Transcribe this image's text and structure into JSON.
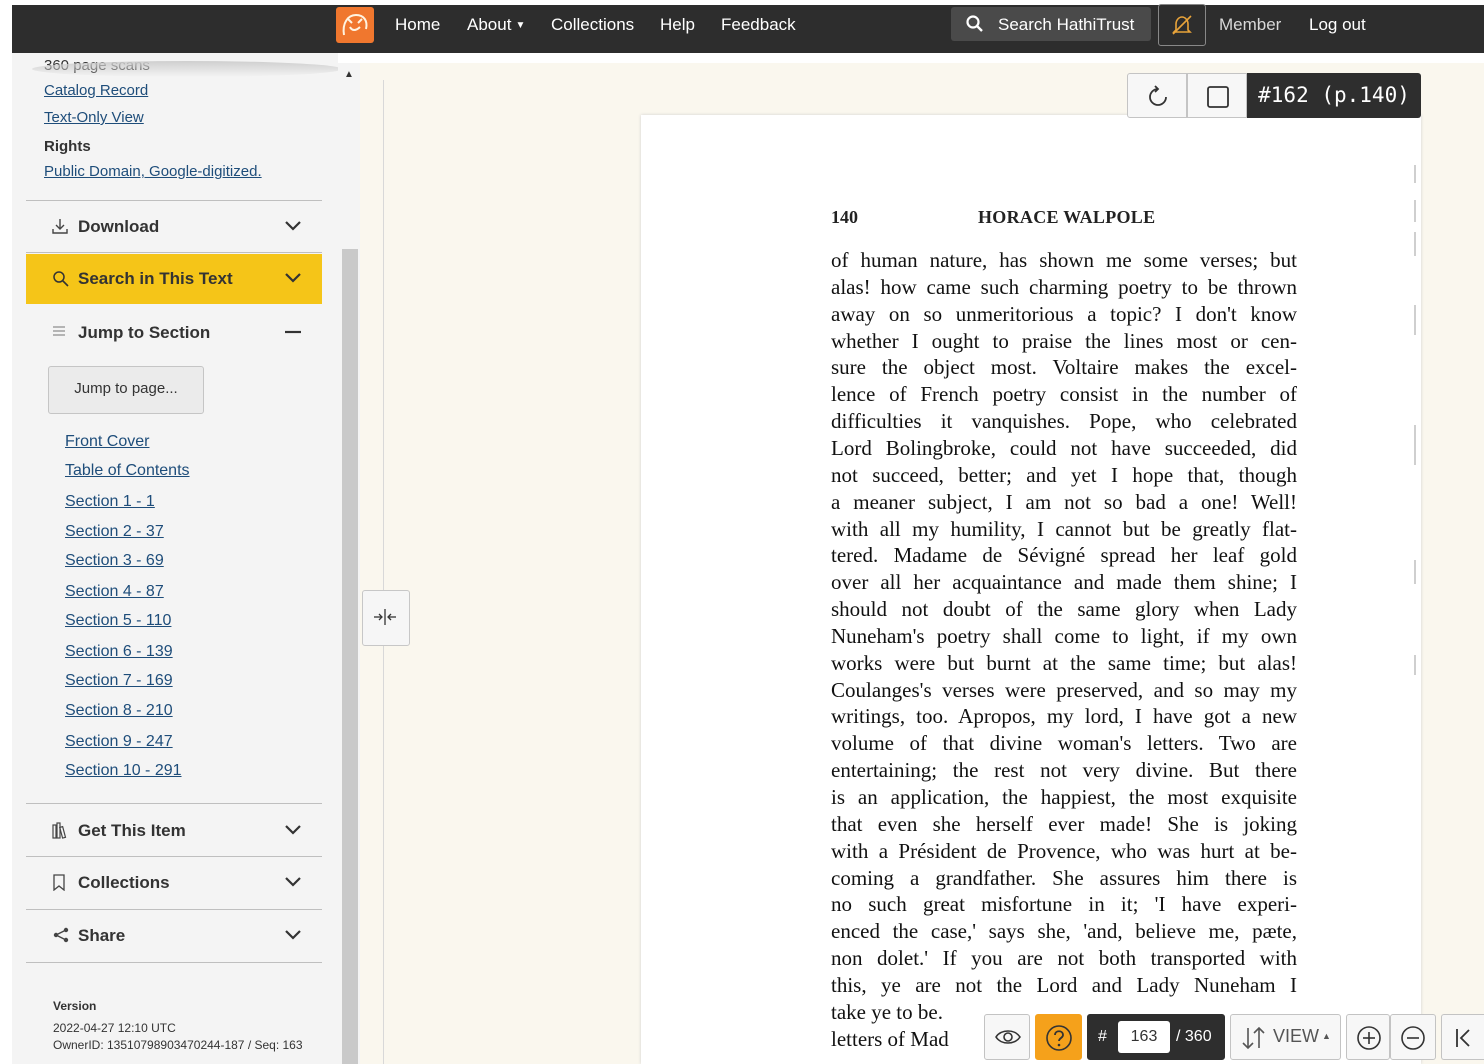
{
  "nav": {
    "items": [
      "Home",
      "About",
      "Collections",
      "Help",
      "Feedback"
    ],
    "search_label": "Search HathiTrust",
    "member_label": "Member",
    "logout_label": "Log out"
  },
  "sidebar": {
    "scans_text": "360 page scans",
    "catalog_link": "Catalog Record",
    "text_only_link": "Text-Only View",
    "rights_heading": "Rights",
    "rights_link": "Public Domain, Google-digitized.",
    "download_label": "Download",
    "search_text_label": "Search in This Text",
    "jump_section_label": "Jump to Section",
    "jump_page_button": "Jump to page...",
    "sections": [
      "Front Cover",
      "Table of Contents",
      "Section 1 - 1",
      "Section 2 - 37",
      "Section 3 - 69",
      "Section 4 - 87",
      "Section 5 - 110",
      "Section 6 - 139",
      "Section 7 - 169",
      "Section 8 - 210",
      "Section 9 - 247",
      "Section 10 - 291"
    ],
    "get_item_label": "Get This Item",
    "collections_label": "Collections",
    "share_label": "Share",
    "version_heading": "Version",
    "version_date": "2022-04-27 12:10 UTC",
    "version_owner": "OwnerID: 13510798903470244-187 / Seq: 163"
  },
  "viewer": {
    "page_label": "#162 (p.140)",
    "page_number": "140",
    "running_title": "HORACE  WALPOLE",
    "lines": [
      "of human nature, has shown me some verses; but",
      "alas! how came such charming poetry to be thrown",
      "away on so unmeritorious a topic? I don't know",
      "whether I ought to praise the lines most or cen-",
      "sure the object most. Voltaire makes the excel-",
      "lence of French poetry consist in the number of",
      "difficulties it vanquishes. Pope, who celebrated",
      "Lord Bolingbroke, could not have succeeded, did",
      "not succeed, better; and yet I hope that, though",
      "a meaner subject, I am not so bad a one! Well!",
      "with all my humility, I cannot but be greatly flat-",
      "tered. Madame de Sévigné spread her leaf gold",
      "over all her acquaintance and made them shine; I",
      "should not doubt of the same glory when Lady",
      "Nuneham's poetry shall come to light, if my own",
      "works were but burnt at the same time; but alas!",
      "Coulanges's verses were preserved, and so may my",
      "writings, too. Apropos, my lord, I have got a new",
      "volume of that divine woman's letters. Two are",
      "entertaining; the rest not very divine. But there",
      "is an application, the happiest, the most exquisite",
      "that even she herself ever made! She is joking",
      "with a Président de Provence, who was hurt at be-",
      "coming a grandfather. She assures him there is",
      "no such great misfortune in it; 'I have experi-",
      "enced the case,' says she, 'and, believe me, pæte,",
      "non dolet.' If you are not both transported with",
      "this, ye are not the Lord and Lady Nuneham I",
      "take ye to be.",
      "letters of Mad"
    ]
  },
  "bottom_toolbar": {
    "page_input": "163",
    "total": "/ 360",
    "view_label": "VIEW"
  }
}
